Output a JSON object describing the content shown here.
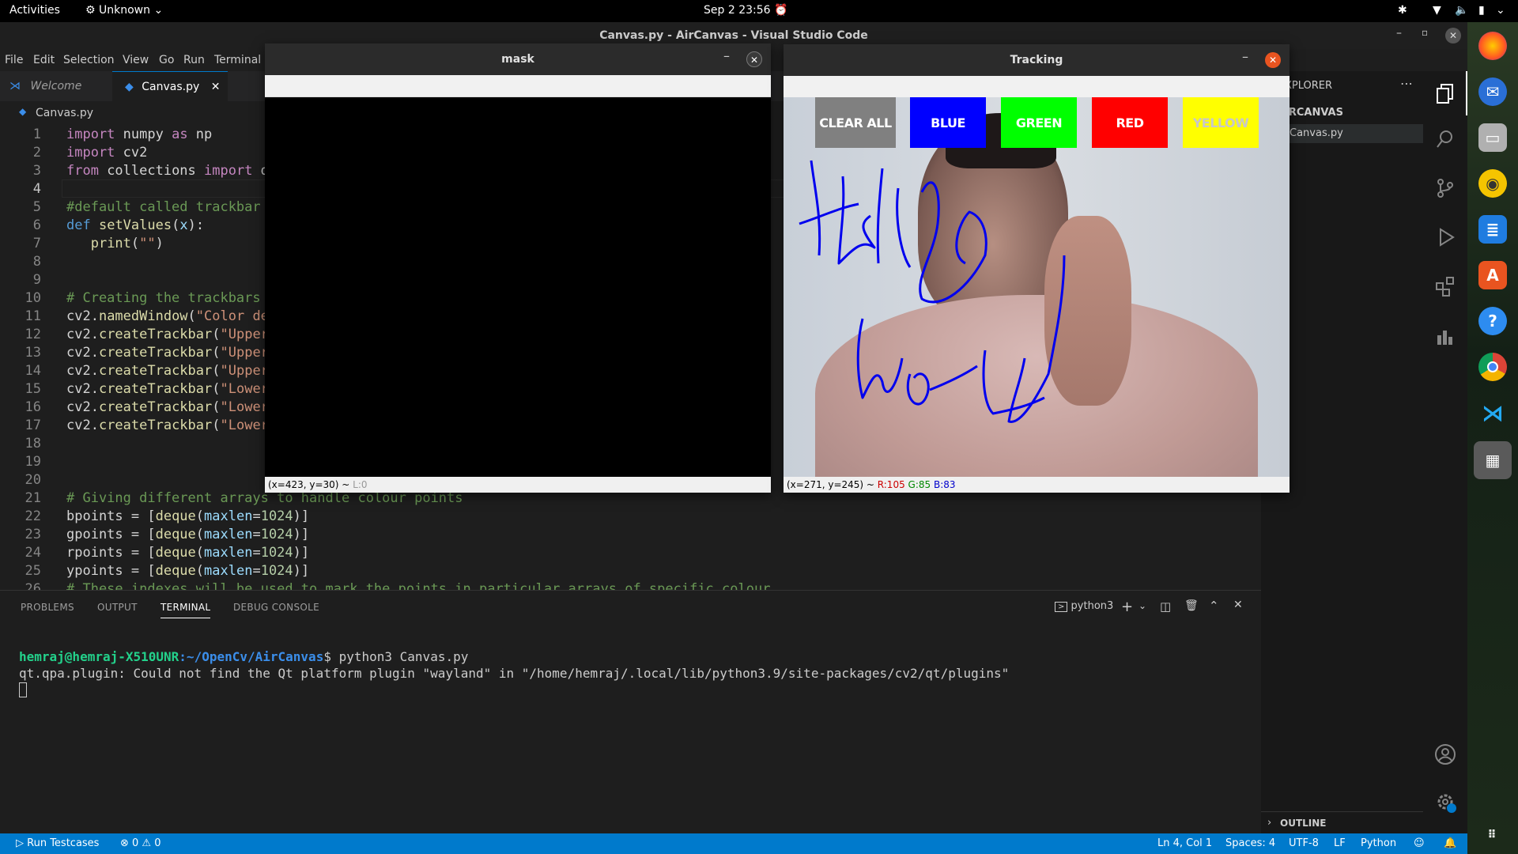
{
  "topbar": {
    "activities": "Activities",
    "app": "Unknown",
    "datetime": "Sep 2  23:56"
  },
  "window_title": "Canvas.py - AirCanvas - Visual Studio Code",
  "menu": [
    "File",
    "Edit",
    "Selection",
    "View",
    "Go",
    "Run",
    "Terminal"
  ],
  "tabs": [
    {
      "label": "Welcome"
    },
    {
      "label": "Canvas.py"
    }
  ],
  "breadcrumb": "Canvas.py",
  "code_lines": [
    {
      "n": "1"
    },
    {
      "n": "2"
    },
    {
      "n": "3"
    },
    {
      "n": "4"
    },
    {
      "n": "5"
    },
    {
      "n": "6"
    },
    {
      "n": "7"
    },
    {
      "n": "8"
    },
    {
      "n": "9"
    },
    {
      "n": "10"
    },
    {
      "n": "11"
    },
    {
      "n": "12"
    },
    {
      "n": "13"
    },
    {
      "n": "14"
    },
    {
      "n": "15"
    },
    {
      "n": "16"
    },
    {
      "n": "17"
    },
    {
      "n": "18"
    },
    {
      "n": "19"
    },
    {
      "n": "20"
    },
    {
      "n": "21"
    },
    {
      "n": "22"
    },
    {
      "n": "23"
    },
    {
      "n": "24"
    },
    {
      "n": "25"
    },
    {
      "n": "26"
    }
  ],
  "panel": {
    "tabs": [
      "PROBLEMS",
      "OUTPUT",
      "TERMINAL",
      "DEBUG CONSOLE"
    ],
    "shell": "python3",
    "prompt_user": "hemraj@hemraj-X510UNR",
    "prompt_path": ":~/OpenCv/AirCanvas",
    "prompt_cmd": "$ python3 Canvas.py",
    "output": "qt.qpa.plugin: Could not find the Qt platform plugin \"wayland\" in \"/home/hemraj/.local/lib/python3.9/site-packages/cv2/qt/plugins\""
  },
  "sidebar": {
    "header": "XPLORER",
    "folder": "IRCANVAS",
    "file": "Canvas.py",
    "outline": "OUTLINE"
  },
  "status": {
    "run": "Run Testcases",
    "problems": "⊗ 0 ⚠ 0",
    "position": "Ln 4, Col 1",
    "spaces": "Spaces: 4",
    "encoding": "UTF-8",
    "eol": "LF",
    "language": "Python"
  },
  "mask_window": {
    "title": "mask",
    "status": "(x=423, y=30) ~ ",
    "status_l": "L:0"
  },
  "tracking_window": {
    "title": "Tracking",
    "buttons": [
      {
        "label": "CLEAR ALL",
        "color": "#808080"
      },
      {
        "label": "BLUE",
        "color": "#0000ff"
      },
      {
        "label": "GREEN",
        "color": "#00ff00"
      },
      {
        "label": "RED",
        "color": "#ff0000"
      },
      {
        "label": "YELLOW",
        "color": "#ffff00"
      }
    ],
    "status_pos": "(x=271, y=245) ~ ",
    "r": "R:105",
    "g": "G:85",
    "b": "B:83"
  },
  "colors": {
    "accent": "#007acc",
    "terminal_user": "#23d18b",
    "terminal_path": "#3b8eea"
  }
}
